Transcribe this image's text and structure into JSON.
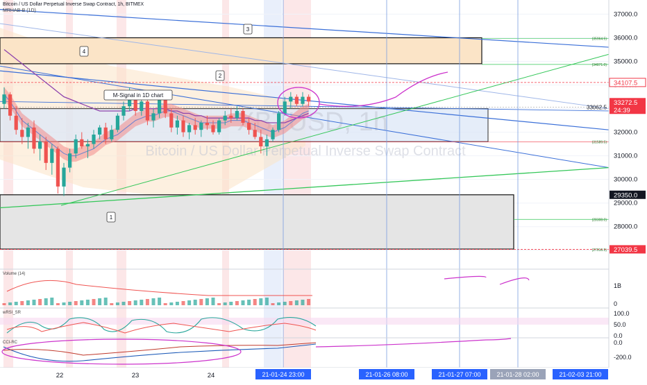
{
  "header": {
    "title": "Bitcoin / US Dollar Perpetual Inverse Swap Contract, 1h, BITMEX",
    "indicator": "MRHAB-B (1D)"
  },
  "watermark": {
    "symbol": "XBTUSD, 1h",
    "description": "Bitcoin / US Dollar Perpetual Inverse Swap Contract"
  },
  "colors": {
    "up": "#26a69a",
    "down": "#ef5350",
    "trend_blue": "#3a6fd8",
    "trend_green": "#34c759",
    "zone_orange": "#fbe4c7",
    "zone_blue": "#dde8f8",
    "zone_gray": "#e5e5e5",
    "vline": "#7a9ee0",
    "marker_pink": "#cc33cc",
    "price_label_red": "#f23645",
    "axis_label_blue": "#2962ff"
  },
  "chart_data": {
    "type": "candlestick",
    "price_axis": {
      "range": [
        26200,
        37600
      ],
      "ticks": [
        "37000.0",
        "36000.0",
        "35000.0",
        "34000.0",
        "33000.0",
        "32000.0",
        "31000.0",
        "30000.0",
        "29000.0",
        "28000.0",
        "27000.0"
      ]
    },
    "price_labels": [
      {
        "text": "34107.5",
        "value": 34107.5,
        "style": "outline-red"
      },
      {
        "text": "33272.5",
        "value": 33272.5,
        "style": "red"
      },
      {
        "text": "24:39",
        "value": 32950,
        "style": "red"
      },
      {
        "text": "29350.0",
        "value": 29350.0,
        "style": "black"
      },
      {
        "text": "27039.5",
        "value": 27039.5,
        "style": "red"
      }
    ],
    "level_notes": [
      {
        "text": "(35964.5)",
        "value": 35964.5
      },
      {
        "text": "(34871.0)",
        "value": 34871.0
      },
      {
        "text": "(31589.5)",
        "value": 31589.5
      },
      {
        "text": "(28308.0)",
        "value": 28308.0
      },
      {
        "text": "(27016.5)",
        "value": 27016.5
      }
    ],
    "crosshair_note": "33062.5",
    "annotations": [
      {
        "text": "M-Signal in 1D chart"
      },
      {
        "text": "1"
      },
      {
        "text": "2"
      },
      {
        "text": "3"
      },
      {
        "text": "4"
      }
    ],
    "time_axis": {
      "ticks": [
        "22",
        "23",
        "24"
      ],
      "highlighted": [
        "21-01-24   23:00",
        "21-01-26   08:00",
        "21-01-27   07:00",
        "21-01-28   02:00",
        "21-02-03   21:00"
      ]
    },
    "candles": [
      [
        33200,
        33900,
        33000,
        33600
      ],
      [
        33600,
        33700,
        32500,
        32700
      ],
      [
        32700,
        33100,
        31900,
        32100
      ],
      [
        32100,
        32600,
        31500,
        31800
      ],
      [
        31800,
        32400,
        31300,
        32200
      ],
      [
        32200,
        32500,
        31100,
        31300
      ],
      [
        31300,
        31900,
        30800,
        31600
      ],
      [
        31600,
        31800,
        30400,
        30700
      ],
      [
        30700,
        31500,
        30200,
        31300
      ],
      [
        31300,
        31400,
        29400,
        29700
      ],
      [
        29700,
        30700,
        29300,
        30500
      ],
      [
        30500,
        31300,
        30300,
        31100
      ],
      [
        31100,
        31900,
        30900,
        31700
      ],
      [
        31700,
        32000,
        31300,
        31400
      ],
      [
        31400,
        31700,
        30900,
        31500
      ],
      [
        31500,
        32100,
        31300,
        31900
      ],
      [
        31900,
        32300,
        31700,
        32200
      ],
      [
        32200,
        32400,
        31500,
        31700
      ],
      [
        31700,
        32300,
        31600,
        32100
      ],
      [
        32100,
        32800,
        32000,
        32700
      ],
      [
        32700,
        33300,
        32500,
        33100
      ],
      [
        33100,
        33900,
        32900,
        33600
      ],
      [
        33600,
        33800,
        32700,
        32900
      ],
      [
        32900,
        33500,
        32700,
        33300
      ],
      [
        33300,
        33400,
        32300,
        32500
      ],
      [
        32500,
        33000,
        32200,
        32800
      ],
      [
        32800,
        33500,
        32600,
        33400
      ],
      [
        33400,
        33600,
        32600,
        32800
      ],
      [
        32800,
        33000,
        32000,
        32200
      ],
      [
        32200,
        32700,
        31900,
        32500
      ],
      [
        32500,
        32700,
        31800,
        32000
      ],
      [
        32000,
        32400,
        31700,
        32300
      ],
      [
        32300,
        32600,
        31900,
        32100
      ],
      [
        32100,
        32500,
        31800,
        32400
      ],
      [
        32400,
        32700,
        32100,
        32300
      ],
      [
        32300,
        32500,
        31900,
        32000
      ],
      [
        32000,
        32600,
        31900,
        32500
      ],
      [
        32500,
        32900,
        32300,
        32700
      ],
      [
        32700,
        33000,
        32400,
        32600
      ],
      [
        32600,
        33100,
        32500,
        32900
      ],
      [
        32900,
        33000,
        32300,
        32400
      ],
      [
        32400,
        32600,
        31900,
        32100
      ],
      [
        32100,
        32400,
        31700,
        31800
      ],
      [
        31800,
        32100,
        31100,
        31400
      ],
      [
        31400,
        31900,
        31000,
        31700
      ],
      [
        31700,
        32200,
        31600,
        32100
      ],
      [
        32100,
        32900,
        32000,
        32800
      ],
      [
        32800,
        33500,
        32700,
        33300
      ],
      [
        33300,
        33700,
        33000,
        33500
      ],
      [
        33500,
        33600,
        33100,
        33200
      ],
      [
        33200,
        33700,
        33100,
        33500
      ],
      [
        33500,
        33600,
        33100,
        33300
      ]
    ],
    "ema_fast": [
      33600,
      33300,
      32900,
      32500,
      32300,
      32100,
      31900,
      31700,
      31500,
      31300,
      31100,
      31000,
      31000,
      31100,
      31200,
      31300,
      31500,
      31700,
      31800,
      31900,
      32100,
      32300,
      32500,
      32600,
      32700,
      32700,
      32800,
      32900,
      32900,
      32800,
      32700,
      32600,
      32500,
      32400,
      32400,
      32400,
      32400,
      32400,
      32500,
      32500,
      32500,
      32400,
      32300,
      32200,
      32100,
      32000,
      32100,
      32200,
      32400,
      32600,
      32800,
      32900
    ],
    "ema_slow": [
      35500,
      35300,
      35100,
      34900,
      34700,
      34500,
      34300,
      34100,
      33900,
      33700,
      33500,
      33400,
      33300,
      33200,
      33100,
      33000,
      32900,
      32900,
      32900,
      32900,
      32900,
      32900,
      33000,
      33000,
      33000,
      33000,
      33000,
      33000,
      32900,
      32900,
      32800,
      32800,
      32700,
      32700,
      32600,
      32600,
      32600,
      32600,
      32600,
      32600,
      32600,
      32600,
      32500,
      32500,
      32400,
      32400,
      32400,
      32400,
      32500,
      32600,
      32700,
      32800
    ],
    "panes": [
      {
        "name": "Volume (14)",
        "ticks": [
          "1B",
          "0"
        ]
      },
      {
        "name": "wRSI_SR",
        "ticks": [
          "100.0",
          "50.0",
          "0.0"
        ]
      },
      {
        "name": "CCI-RC",
        "ticks": [
          "0.0",
          "-200.0"
        ]
      }
    ]
  }
}
